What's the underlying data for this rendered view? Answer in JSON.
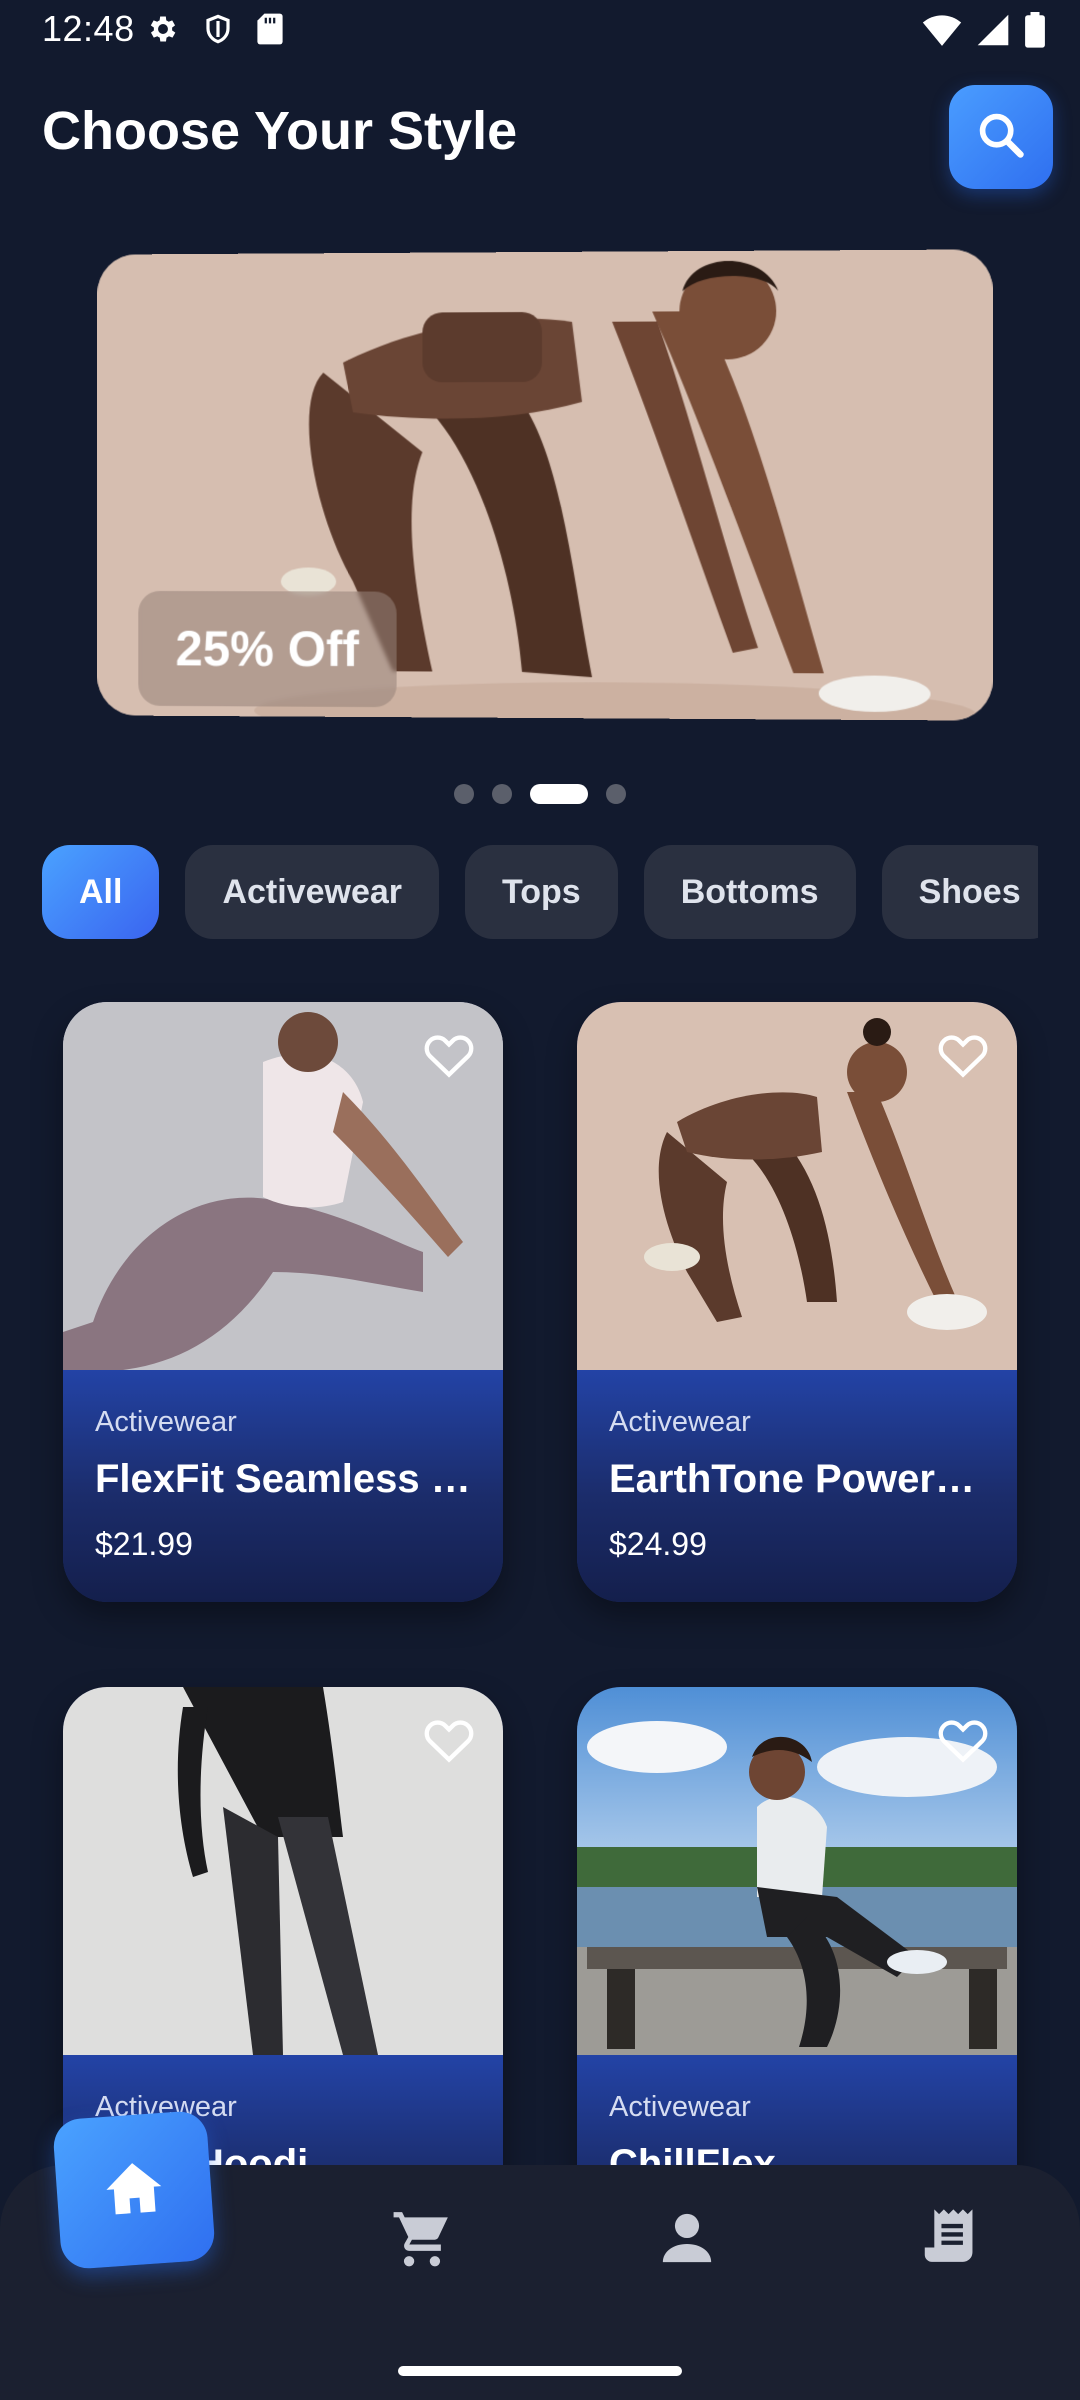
{
  "status_bar": {
    "time": "12:48",
    "left_icons": [
      "gear-icon",
      "shield-icon",
      "sd-card-icon"
    ],
    "right_icons": [
      "wifi-icon",
      "cellular-signal-icon",
      "battery-icon"
    ]
  },
  "header": {
    "title": "Choose Your Style",
    "search_icon": "search-icon"
  },
  "banner": {
    "badge": "25% Off",
    "page_count": 4,
    "active_index": 2
  },
  "categories": [
    {
      "label": "All",
      "active": true
    },
    {
      "label": "Activewear",
      "active": false
    },
    {
      "label": "Tops",
      "active": false
    },
    {
      "label": "Bottoms",
      "active": false
    },
    {
      "label": "Shoes",
      "active": false
    }
  ],
  "products": [
    {
      "category": "Activewear",
      "name": "FlexFit Seamless …",
      "price": "$21.99",
      "favorite": false
    },
    {
      "category": "Activewear",
      "name": "EarthTone Power …",
      "price": "$24.99",
      "favorite": false
    },
    {
      "category": "Activewear",
      "name": "…Fit Hoodi…",
      "price": "",
      "favorite": false
    },
    {
      "category": "Activewear",
      "name": "ChillFlex …",
      "price": "",
      "favorite": false
    }
  ],
  "bottom_nav": [
    {
      "icon": "home-icon",
      "active": true
    },
    {
      "icon": "cart-icon",
      "active": false
    },
    {
      "icon": "profile-icon",
      "active": false
    },
    {
      "icon": "orders-receipt-icon",
      "active": false
    }
  ],
  "colors": {
    "background": "#121a2e",
    "accent": "#3a7ff5",
    "card_info": "#1d2e6c",
    "chip": "#2a3040",
    "nav_bar": "#1b2030"
  }
}
